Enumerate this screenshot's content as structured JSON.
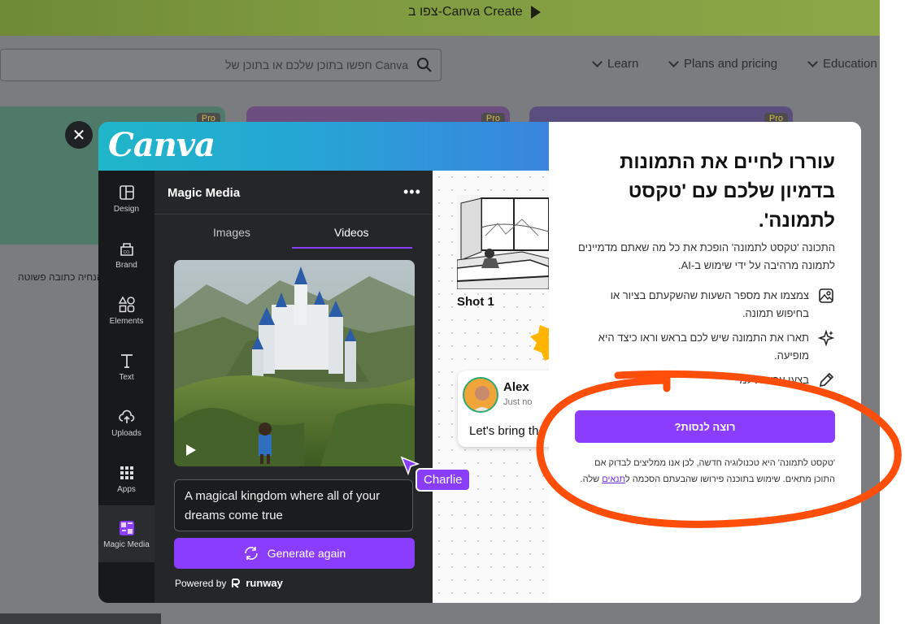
{
  "banner": {
    "text": "צפו ב-Canva Create"
  },
  "header": {
    "search_placeholder": "חפשו בתוכן שלכם או בתוכן של Canva",
    "nav": [
      "Learn",
      "Plans and pricing",
      "Education"
    ]
  },
  "background": {
    "pro_badge": "Pro",
    "side_text": "הנחיה כתובה פשוטה"
  },
  "modal": {
    "logo": "Canva",
    "sidebar": [
      {
        "label": "Design",
        "icon": "layout-icon"
      },
      {
        "label": "Brand",
        "icon": "brand-icon"
      },
      {
        "label": "Elements",
        "icon": "shapes-icon"
      },
      {
        "label": "Text",
        "icon": "text-icon"
      },
      {
        "label": "Uploads",
        "icon": "cloud-upload-icon"
      },
      {
        "label": "Apps",
        "icon": "apps-grid-icon"
      },
      {
        "label": "Magic Media",
        "icon": "magic-media-icon"
      }
    ],
    "panel": {
      "title": "Magic Media",
      "tabs": [
        "Images",
        "Videos"
      ],
      "active_tab": "Videos",
      "prompt": "A magical kingdom where all of your dreams come true",
      "generate_label": "Generate again",
      "powered_by": "Powered by",
      "powered_brand": "runway"
    },
    "canvas": {
      "shot_label": "Shot 1",
      "comment": {
        "name": "Alex",
        "time": "Just no",
        "text": "Let's bring th"
      },
      "cursor_name": "Charlie"
    },
    "info": {
      "title": "עוררו לחיים את התמונות בדמיון שלכם עם 'טקסט לתמונה'.",
      "description": "התכונה 'טקסט לתמונה' הופכת את כל מה שאתם מדמיינים לתמונה מרהיבה על ידי שימוש ב-AI.",
      "features": [
        {
          "icon": "image-icon",
          "text": "צמצמו את מספר השעות שהשקעתם בציור או בחיפוש תמונה."
        },
        {
          "icon": "sparkle-icon",
          "text": "תארו את התמונה שיש לכם בראש וראו כיצד היא מופיעה."
        },
        {
          "icon": "pencil-icon",
          "text": "בצעו עריכות למ"
        }
      ],
      "try_button": "רוצה לנסות?",
      "fine_print": "'טקסט לתמונה' היא טכנולוגיה חדשה, לכן אנו ממליצים לבדוק אם התוכן מתאים. שימוש בתוכנה פירושו שהבעתם הסכמה ל",
      "terms_link": "תנאים",
      "fine_print_end": " שלה."
    }
  },
  "colors": {
    "accent": "#8b3dff",
    "annotation": "#ff4d0a",
    "banner": "#7f9a40"
  }
}
